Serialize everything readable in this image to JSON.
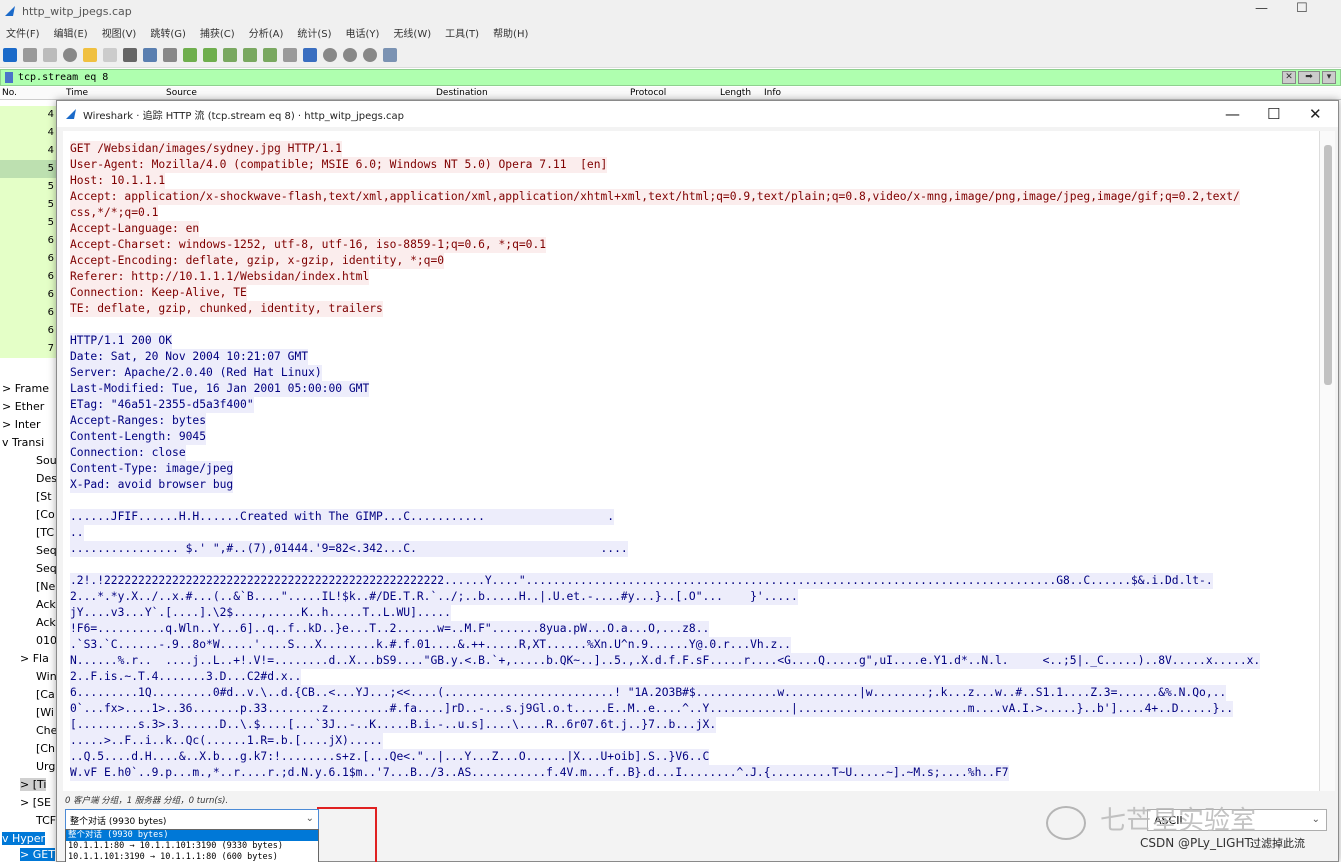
{
  "main_window": {
    "title": "http_witp_jpegs.cap",
    "menu": [
      "文件(F)",
      "编辑(E)",
      "视图(V)",
      "跳转(G)",
      "捕获(C)",
      "分析(A)",
      "统计(S)",
      "电话(Y)",
      "无线(W)",
      "工具(T)",
      "帮助(H)"
    ],
    "filter": "tcp.stream eq 8",
    "columns": [
      "No.",
      "Time",
      "Source",
      "Destination",
      "Protocol",
      "Length",
      "Info"
    ]
  },
  "packet_list": [
    {
      "no": "4"
    },
    {
      "no": "4"
    },
    {
      "no": "4"
    },
    {
      "no": "5"
    },
    {
      "no": "5"
    },
    {
      "no": "5"
    },
    {
      "no": "5"
    },
    {
      "no": "6"
    },
    {
      "no": "6"
    },
    {
      "no": "6"
    },
    {
      "no": "6"
    },
    {
      "no": "6"
    },
    {
      "no": "6"
    },
    {
      "no": "7"
    }
  ],
  "details_tree": [
    {
      "text": "Frame",
      "arrow": ">"
    },
    {
      "text": "Ether",
      "arrow": ">"
    },
    {
      "text": "Inter",
      "arrow": ">"
    },
    {
      "text": "Transi",
      "arrow": "v"
    },
    {
      "text": "Sou",
      "arrow": ""
    },
    {
      "text": "Des",
      "arrow": ""
    },
    {
      "text": "[St",
      "arrow": ""
    },
    {
      "text": "[Co",
      "arrow": ""
    },
    {
      "text": "[TC",
      "arrow": ""
    },
    {
      "text": "Seq",
      "arrow": ""
    },
    {
      "text": "Seq",
      "arrow": ""
    },
    {
      "text": "[Ne",
      "arrow": ""
    },
    {
      "text": "Ack",
      "arrow": ""
    },
    {
      "text": "Ack",
      "arrow": ""
    },
    {
      "text": "010",
      "arrow": ""
    },
    {
      "text": "Fla",
      "arrow": ">"
    },
    {
      "text": "Win",
      "arrow": ""
    },
    {
      "text": "[Ca",
      "arrow": ""
    },
    {
      "text": "[Wi",
      "arrow": ""
    },
    {
      "text": "Che",
      "arrow": ""
    },
    {
      "text": "[Ch",
      "arrow": ""
    },
    {
      "text": "Urg",
      "arrow": ""
    },
    {
      "text": "[Ti",
      "arrow": ">"
    },
    {
      "text": "[SE",
      "arrow": ">"
    },
    {
      "text": "TCF",
      "arrow": ""
    },
    {
      "text": "Hyper",
      "arrow": "v"
    },
    {
      "text": "GET",
      "arrow": ">"
    }
  ],
  "dialog": {
    "title": "Wireshark · 追踪 HTTP 流 (tcp.stream eq 8) · http_witp_jpegs.cap",
    "request_lines": [
      "GET /Websidan/images/sydney.jpg HTTP/1.1",
      "User-Agent: Mozilla/4.0 (compatible; MSIE 6.0; Windows NT 5.0) Opera 7.11  [en]",
      "Host: 10.1.1.1",
      "Accept: application/x-shockwave-flash,text/xml,application/xml,application/xhtml+xml,text/html;q=0.9,text/plain;q=0.8,video/x-mng,image/png,image/jpeg,image/gif;q=0.2,text/",
      "css,*/*;q=0.1",
      "Accept-Language: en",
      "Accept-Charset: windows-1252, utf-8, utf-16, iso-8859-1;q=0.6, *;q=0.1",
      "Accept-Encoding: deflate, gzip, x-gzip, identity, *;q=0",
      "Referer: http://10.1.1.1/Websidan/index.html",
      "Connection: Keep-Alive, TE",
      "TE: deflate, gzip, chunked, identity, trailers"
    ],
    "response_lines": [
      "HTTP/1.1 200 OK",
      "Date: Sat, 20 Nov 2004 10:21:07 GMT",
      "Server: Apache/2.0.40 (Red Hat Linux)",
      "Last-Modified: Tue, 16 Jan 2001 05:00:00 GMT",
      "ETag: \"46a51-2355-d5a3f400\"",
      "Accept-Ranges: bytes",
      "Content-Length: 9045",
      "Connection: close",
      "Content-Type: image/jpeg",
      "X-Pad: avoid browser bug"
    ],
    "data_lines_a": [
      "......JFIF......H.H......Created with The GIMP...C...........                  .",
      "..",
      "................ $.' \",#..(7),01444.'9=82<.342...C.                           ...."
    ],
    "data_lines_b": [
      ".2!.!22222222222222222222222222222222222222222222222222......Y....\"..............................................................................G8..C......$&.i.Dd.lt-.",
      "2...*.*y.X../..x.#...(..&`B....\".....IL!$k..#/DE.T.R.`../;..b.....H..|.U.et.-....#y...}..[.O\"...    }'.....",
      "jY....v3...Y`.[....].\\2$....,.....K..h.....T..L.WU].....",
      "!F6=..........q.Wln..Y...6]..q..f..kD..}e...T..2......w=..M.F\".......8yua.pW...O.a...O,...z8..",
      ".`S3.`C......-.9..8o*W.....'....S...X........k.#.f.01....&.++.....R,XT......%Xn.U^n.9......Y@.0.r...Vh.z..",
      "N......%.r..  ....j..L..+!.V!=........d..X...bS9....\"GB.y.<.B.`+,.....b.QK~..]..5.,.X.d.f.F.sF.....r....<G....Q.....g\",uI....e.Y1.d*..N.l.     <..;5|._C.....)..8V.....x.....x.",
      "2..F.is.~.T.4.......3.D...C2#d.x..",
      "6.........1Q.........0#d..v.\\..d.{CB..<...YJ...;<<....(.........................! \"1A.2O3B#$............w...........|w........;.k...z...w..#..S1.1....Z.3=......&%.N.Qo,..",
      "0`...fx>....1>..36.......p.33........z.........#.fa....]rD..-...s.j9Gl.o.t.....E..M..e....^..Y............|.........................m....vA.I.>.....}..b']....4+..D.....}..",
      "[.........s.3>.3......D..\\.$....[...`3J..-..K.....B.i.-..u.s]....\\....R..6r07.6t.j..}7..b...jX.",
      ".....>..F..i..k..Qc(......1.R=.b.[....jX).....",
      "..Q.5....d.H....&..X.b...g.k7:!........s+z.[...Qe<.\"..|...Y...Z...O......|X...U+oib].S..}V6..C",
      "W.vF E.h0`..9.p...m.,*..r....r.;d.N.y.6.1$m..'7...B../3..AS...........f.4V.m...f..B}.d...I........^.J.{.........T~U.....~].~M.s;....%h..F7"
    ],
    "status_text": "0 客户端 分组，1 服务器 分组，0 turn(s).",
    "show_combo": {
      "selected": "整个对话 (9930 bytes)",
      "options": [
        "整个对话 (9930 bytes)",
        "10.1.1.1:80 → 10.1.1.101:3190 (9330 bytes)",
        "10.1.1.101:3190 → 10.1.1.1:80 (600 bytes)"
      ]
    },
    "format_combo": "ASCII",
    "close_button": "过滤掉此流"
  },
  "watermark": {
    "brand": "七芒星实验室",
    "sub": "CSDN @PLy_LIGHT"
  },
  "colors": {
    "filter_bg": "#afffaf",
    "request_fg": "#7f0000",
    "request_bg": "#fbeded",
    "response_fg": "#000080",
    "response_bg": "#ededfb",
    "highlight": "#e02020",
    "selection": "#0078d7"
  }
}
